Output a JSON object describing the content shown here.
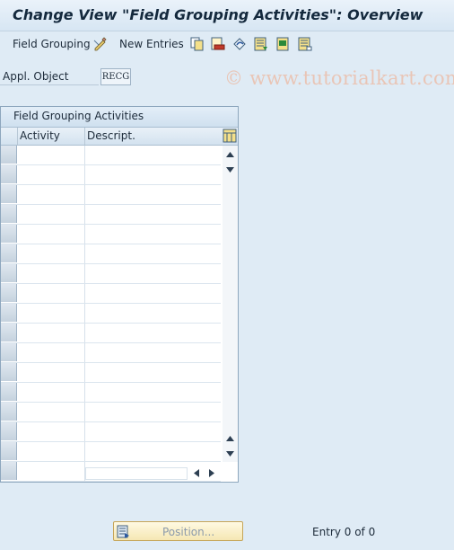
{
  "window": {
    "title": "Change View \"Field Grouping Activities\": Overview"
  },
  "toolbar": {
    "field_grouping_label": "Field Grouping",
    "new_entries_label": "New Entries",
    "watermark": "© www.tutorialkart.com"
  },
  "form": {
    "appl_object_label": "Appl. Object",
    "appl_object_value": "RECG"
  },
  "table": {
    "title": "Field Grouping Activities",
    "columns": [
      "Activity",
      "Descript."
    ],
    "rows": 17
  },
  "footer": {
    "position_label": "Position...",
    "entry_text": "Entry 0 of 0"
  }
}
